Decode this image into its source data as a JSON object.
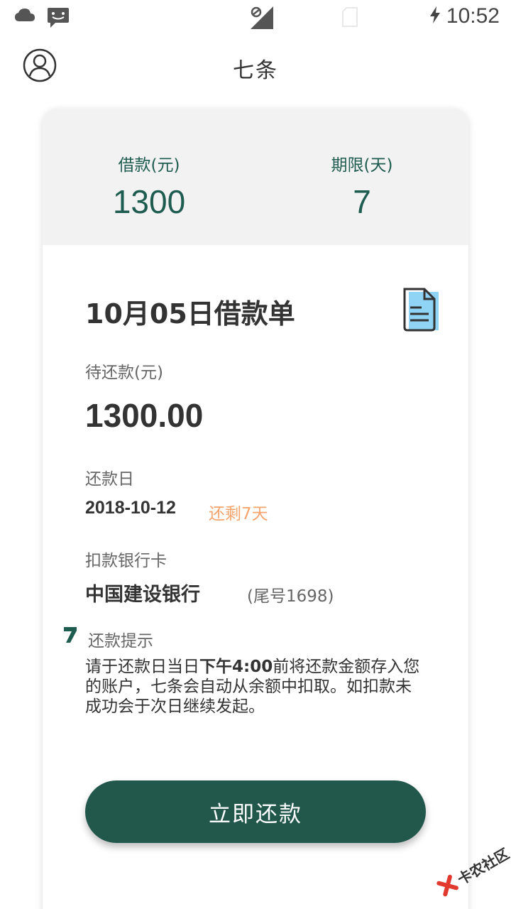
{
  "status_bar": {
    "time": "10:52",
    "icons": [
      "cloud-icon",
      "message-icon",
      "no-signal-icon",
      "sim-card-icon",
      "charging-icon"
    ]
  },
  "header": {
    "title": "七条",
    "avatar_icon": "user-circle-icon"
  },
  "summary": {
    "loan_label": "借款(元)",
    "loan_value": "1300",
    "term_label": "期限(天)",
    "term_value": "7"
  },
  "bill": {
    "title": "10月05日借款单",
    "doc_icon": "document-icon",
    "due_label": "待还款(元)",
    "due_amount": "1300.00",
    "date_label": "还款日",
    "date_value": "2018-10-12",
    "days_left": "还剩7天",
    "bank_label": "扣款银行卡",
    "bank_name": "中国建设银行",
    "card_tail": "(尾号1698)"
  },
  "tip": {
    "label": "还款提示",
    "text_before": "请于还款日当日",
    "text_bold": "下午4:00",
    "text_after": "前将还款金额存入您的账户，七条会自动从余额中扣取。如扣款未成功会于次日继续发起。"
  },
  "actions": {
    "repay_label": "立即还款"
  },
  "watermark": {
    "text": "卡农社区"
  },
  "colors": {
    "primary": "#22574b",
    "accent_text": "#1f5c50",
    "warning": "#f5a46e",
    "summary_bg": "#f2f2f2"
  }
}
